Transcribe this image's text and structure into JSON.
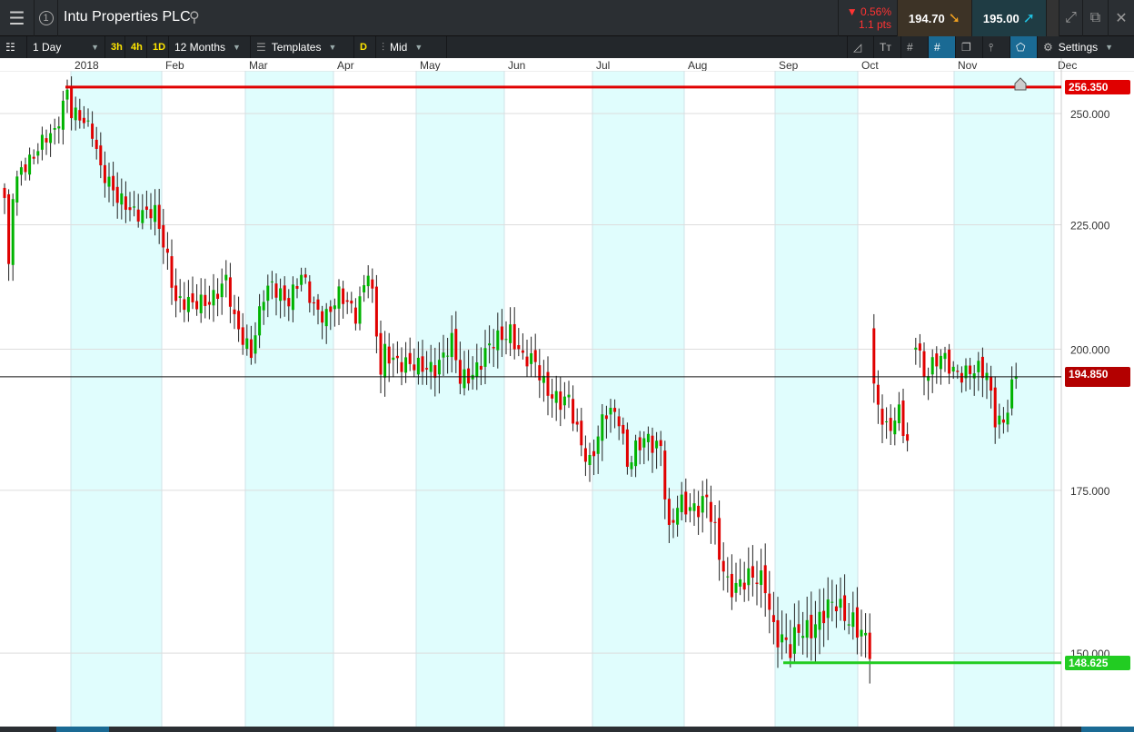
{
  "header": {
    "title": "Intu Properties PLC",
    "change_pct": "▼ 0.56%",
    "change_pts": "1.1 pts",
    "sell": "194.70",
    "buy": "195.00",
    "window_num": "1"
  },
  "toolbar": {
    "interval": "1 Day",
    "q3h": "3h",
    "q4h": "4h",
    "q1d": "1D",
    "range": "12 Months",
    "templates": "Templates",
    "d": "D",
    "price_type": "Mid",
    "settings": "Settings"
  },
  "colors": {
    "up": "#00b300",
    "down": "#e00000",
    "band": "#e0fdfd",
    "resistance": "#e00000",
    "support": "#22cc22",
    "last": "#b30000"
  },
  "chart_data": {
    "type": "candlestick",
    "scale": "log",
    "ylim": [
      140,
      262
    ],
    "x_labels": [
      "2018",
      "Feb",
      "Mar",
      "Apr",
      "May",
      "Jun",
      "Jul",
      "Aug",
      "Sep",
      "Oct",
      "Nov",
      "Dec"
    ],
    "y_ticks": [
      "250.000",
      "225.000",
      "200.000",
      "175.000",
      "150.000"
    ],
    "y_tick_values": [
      250,
      225,
      200,
      175,
      150
    ],
    "levels": {
      "resistance": {
        "value": 256.35,
        "label": "256.350"
      },
      "support": {
        "value": 148.625,
        "label": "148.625"
      },
      "last": {
        "value": 194.85,
        "label": "194.850"
      }
    },
    "trading_days": 243,
    "missing_days": [
      217
    ],
    "close_anchors": [
      [
        0,
        230
      ],
      [
        1,
        215
      ],
      [
        2,
        232
      ],
      [
        4,
        238
      ],
      [
        7,
        240
      ],
      [
        10,
        244
      ],
      [
        12,
        246
      ],
      [
        15,
        256
      ],
      [
        16,
        250
      ],
      [
        21,
        246
      ],
      [
        23,
        238
      ],
      [
        27,
        230
      ],
      [
        32,
        228
      ],
      [
        36,
        227
      ],
      [
        39,
        218
      ],
      [
        41,
        210
      ],
      [
        45,
        208
      ],
      [
        49,
        210
      ],
      [
        53,
        213
      ],
      [
        55,
        205
      ],
      [
        59,
        200
      ],
      [
        62,
        210
      ],
      [
        64,
        212
      ],
      [
        68,
        210
      ],
      [
        71,
        214
      ],
      [
        74,
        208
      ],
      [
        77,
        207
      ],
      [
        80,
        210
      ],
      [
        84,
        207
      ],
      [
        87,
        216
      ],
      [
        88,
        210
      ],
      [
        90,
        195
      ],
      [
        91,
        199
      ],
      [
        95,
        198
      ],
      [
        99,
        196
      ],
      [
        103,
        197
      ],
      [
        107,
        201
      ],
      [
        109,
        194
      ],
      [
        112,
        196
      ],
      [
        116,
        200
      ],
      [
        121,
        204
      ],
      [
        124,
        198
      ],
      [
        127,
        197
      ],
      [
        129,
        194
      ],
      [
        133,
        190
      ],
      [
        135,
        190
      ],
      [
        137,
        185
      ],
      [
        140,
        180
      ],
      [
        144,
        188
      ],
      [
        147,
        188
      ],
      [
        149,
        180
      ],
      [
        153,
        183
      ],
      [
        157,
        183
      ],
      [
        159,
        168
      ],
      [
        161,
        172
      ],
      [
        164,
        172
      ],
      [
        168,
        174
      ],
      [
        171,
        164
      ],
      [
        173,
        160
      ],
      [
        177,
        161
      ],
      [
        182,
        160
      ],
      [
        184,
        154
      ],
      [
        186,
        152
      ],
      [
        188,
        150
      ],
      [
        190,
        153
      ],
      [
        195,
        155
      ],
      [
        199,
        157
      ],
      [
        203,
        155
      ],
      [
        207,
        150
      ],
      [
        208,
        192
      ],
      [
        211,
        186
      ],
      [
        214,
        188
      ],
      [
        216,
        182
      ],
      [
        218,
        202
      ],
      [
        220,
        196
      ],
      [
        224,
        198
      ],
      [
        227,
        196
      ],
      [
        231,
        196
      ],
      [
        235,
        195
      ],
      [
        237,
        188
      ],
      [
        239,
        187
      ],
      [
        242,
        195
      ]
    ]
  }
}
